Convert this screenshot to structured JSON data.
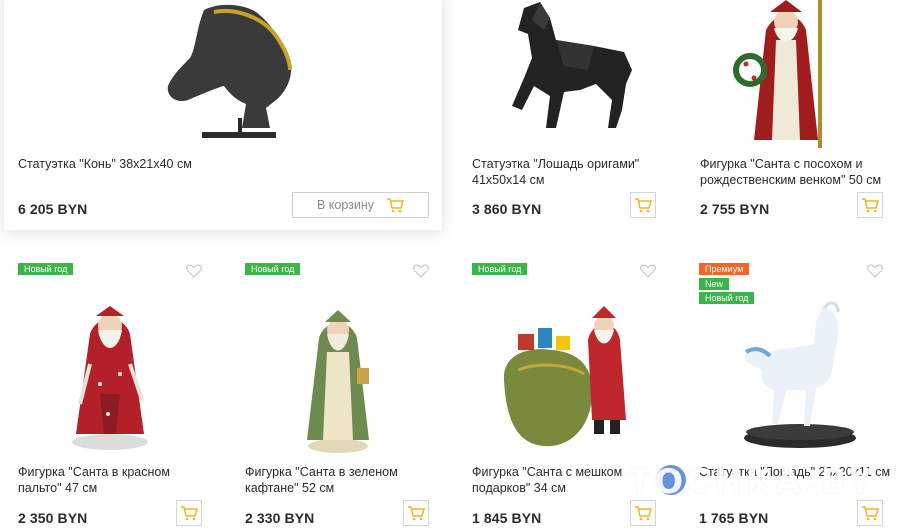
{
  "colors": {
    "cart_icon": "#f0b429",
    "badge_green": "#3bb44a",
    "badge_orange": "#f26522",
    "heart": "#c8c8c8",
    "watermark_dot": "#4c7fd6"
  },
  "products": [
    {
      "title": "Статуэтка \"Конь\" 38x21x40 см",
      "price": "6 205 BYN",
      "cart_label": "В корзину",
      "badges": []
    },
    {
      "title": "Статуэтка \"Лошадь оригами\" 41x50x14 см",
      "price": "3 860 BYN",
      "badges": []
    },
    {
      "title": "Фигурка \"Санта с посохом и рождественским венком\" 50 см",
      "price": "2 755 BYN",
      "badges": []
    },
    {
      "title": "Фигурка \"Санта в красном пальто\" 47 см",
      "price": "2 350 BYN",
      "badges": [
        "Новый год"
      ]
    },
    {
      "title": "Фигурка \"Санта в зеленом кафтане\" 52 см",
      "price": "2 330 BYN",
      "badges": [
        "Новый год"
      ]
    },
    {
      "title": "Фигурка \"Санта с мешком подарков\" 34 см",
      "price": "1 845 BYN",
      "badges": [
        "Новый год"
      ]
    },
    {
      "title": "Статуэтка \"Лошадь\" 23x20x11 см",
      "price": "1 765 BYN",
      "badges": [
        "Премиум",
        "New",
        "Новый год"
      ]
    }
  ],
  "watermark": {
    "text": "TOCHKA.BY"
  }
}
